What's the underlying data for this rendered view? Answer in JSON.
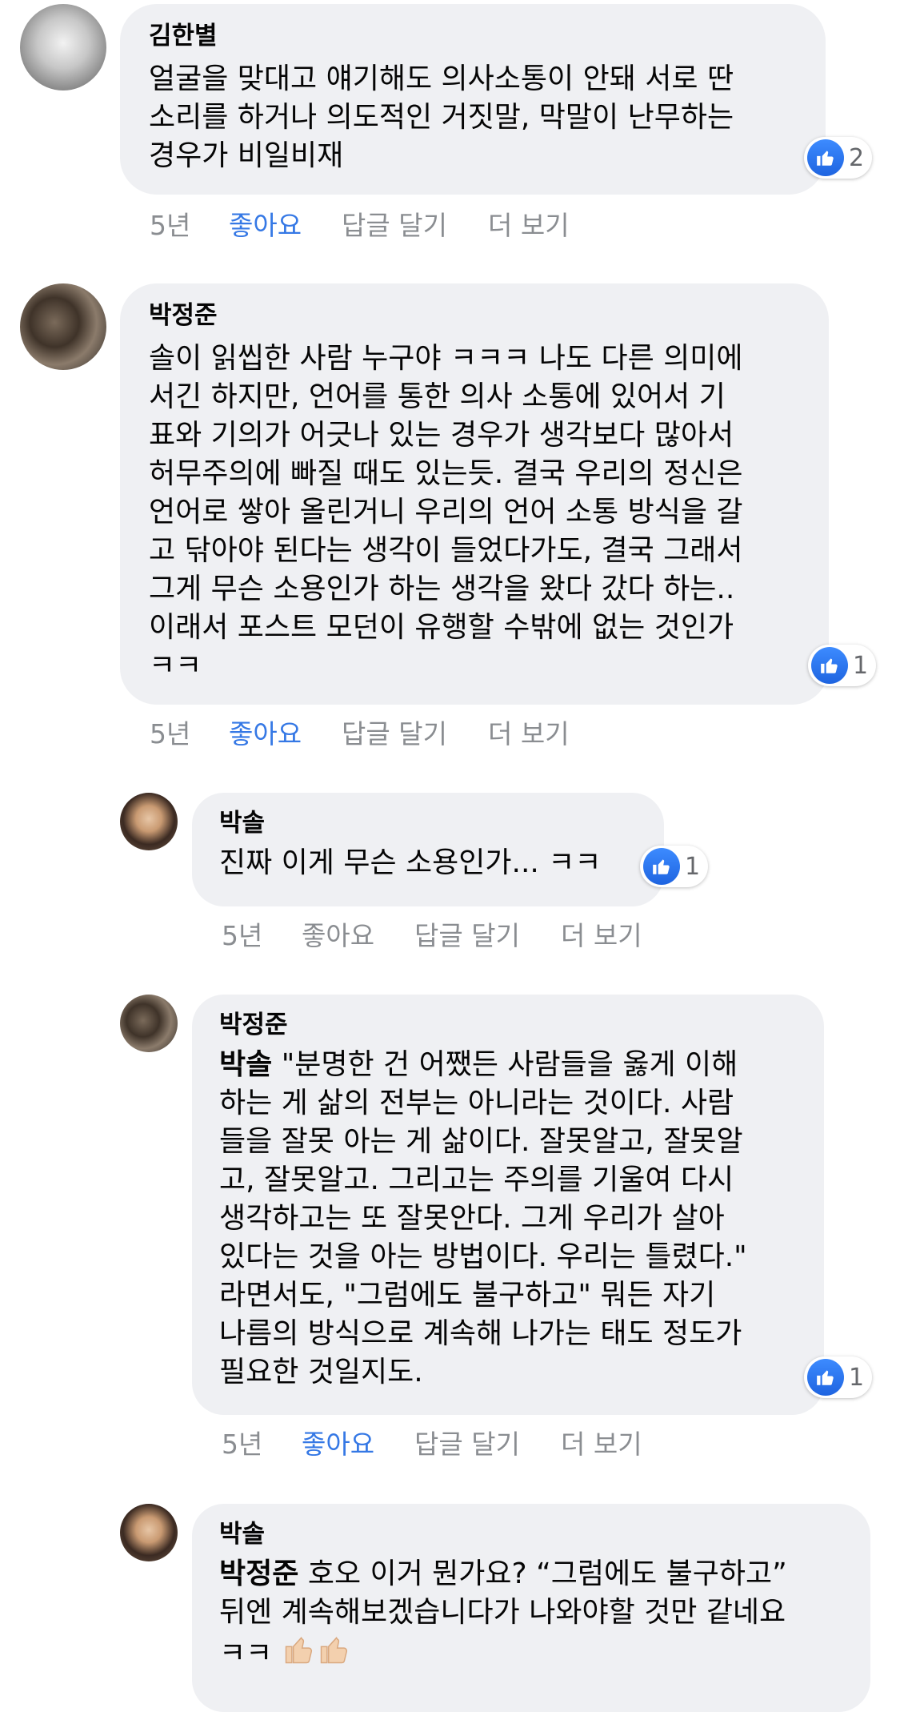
{
  "comments": [
    {
      "author": "김한별",
      "text": "얼굴을 맞대고 얘기해도 의사소통이 안돼 서로 딴\n소리를 하거나 의도적인 거짓말, 막말이 난무하는\n경우가 비일비재",
      "reactions": "2",
      "time": "5년",
      "like": "좋아요",
      "reply": "답글 달기",
      "more": "더 보기"
    },
    {
      "author": "박정준",
      "text": "솔이 읽씹한 사람 누구야 ㅋㅋㅋ 나도 다른 의미에\n서긴 하지만, 언어를 통한 의사 소통에 있어서 기\n표와 기의가 어긋나 있는 경우가 생각보다 많아서\n허무주의에 빠질 때도 있는듯. 결국 우리의 정신은\n언어로 쌓아 올린거니 우리의 언어 소통 방식을 갈\n고 닦아야 된다는 생각이 들었다가도, 결국 그래서\n그게 무슨 소용인가 하는 생각을 왔다 갔다 하는..\n이래서 포스트 모던이 유행할 수밖에 없는 것인가\nㅋㅋ",
      "reactions": "1",
      "time": "5년",
      "like": "좋아요",
      "reply": "답글 달기",
      "more": "더 보기"
    },
    {
      "author": "박솔",
      "text": "진짜 이게 무슨 소용인가... ㅋㅋ",
      "reactions": "1",
      "time": "5년",
      "like": "좋아요",
      "reply": "답글 달기",
      "more": "더 보기"
    },
    {
      "author": "박정준",
      "mention": "박솔",
      "text": " \"분명한 건 어쨌든 사람들을 옳게 이해\n하는 게 삶의 전부는 아니라는 것이다. 사람\n들을 잘못 아는 게 삶이다. 잘못알고, 잘못알\n고, 잘못알고. 그리고는 주의를 기울여 다시\n생각하고는 또 잘못안다. 그게 우리가 살아\n있다는 것을 아는 방법이다. 우리는 틀렸다.\"\n라면서도, \"그럼에도 불구하고\" 뭐든 자기\n나름의 방식으로 계속해 나가는 태도 정도가\n필요한 것일지도.",
      "reactions": "1",
      "time": "5년",
      "like": "좋아요",
      "reply": "답글 달기",
      "more": "더 보기"
    },
    {
      "author": "박솔",
      "mention": "박정준",
      "text": " 호오 이거 뭔가요? “그럼에도 불구하고”\n뒤엔 계속해보겠습니다가 나와야할 것만 같네요\nㅋㅋ "
    }
  ],
  "icons": {
    "reaction": "like-thumb-icon",
    "emoji": "thumbs-up-emoji"
  },
  "colors": {
    "bubble": "#eff0f3",
    "liked": "#3578e5",
    "meta": "#8a8d91"
  }
}
